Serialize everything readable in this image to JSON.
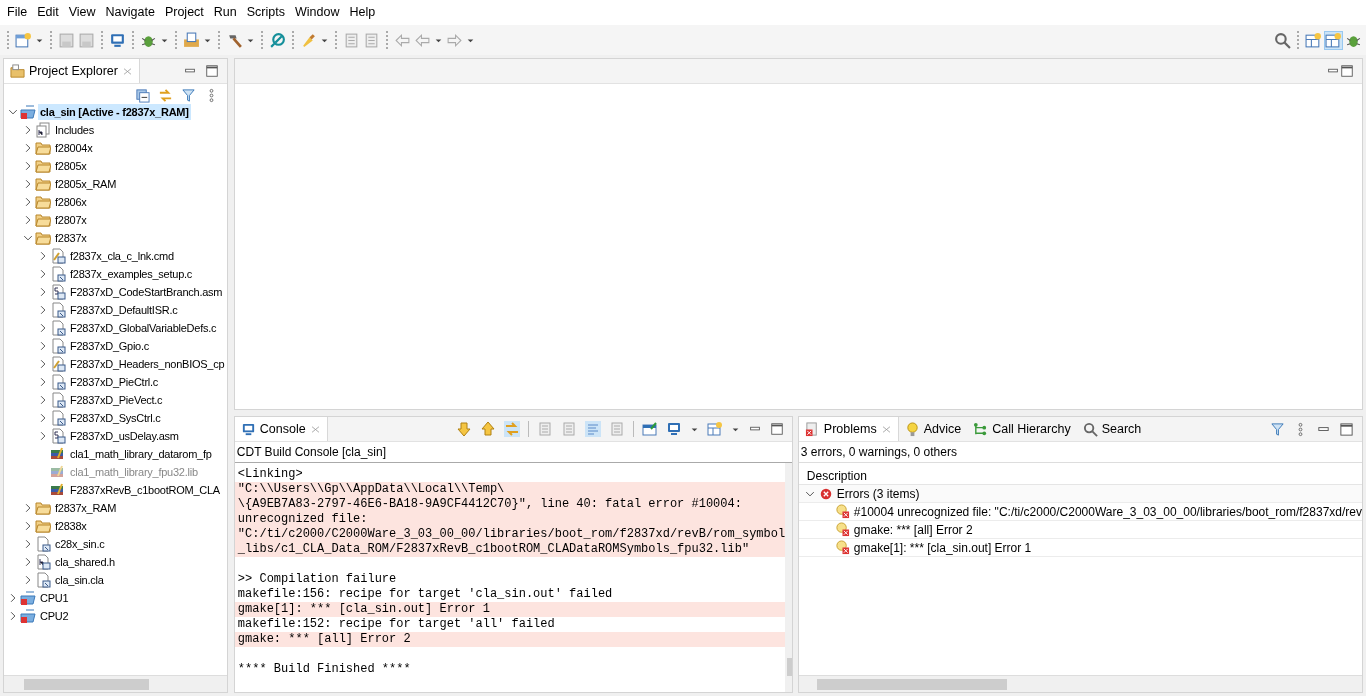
{
  "menu": [
    "File",
    "Edit",
    "View",
    "Navigate",
    "Project",
    "Run",
    "Scripts",
    "Window",
    "Help"
  ],
  "explorer": {
    "title": "Project Explorer",
    "tree": [
      {
        "label": "cla_sin  [Active - f2837x_RAM]",
        "kind": "project",
        "expanded": true,
        "selected": true,
        "children": [
          {
            "label": "Includes",
            "kind": "includes",
            "expanded": false,
            "selected": false
          },
          {
            "label": "f28004x",
            "kind": "folder",
            "expanded": false,
            "selected": false
          },
          {
            "label": "f2805x",
            "kind": "folder",
            "expanded": false,
            "selected": false
          },
          {
            "label": "f2805x_RAM",
            "kind": "folder",
            "expanded": false,
            "selected": false
          },
          {
            "label": "f2806x",
            "kind": "folder",
            "expanded": false,
            "selected": false
          },
          {
            "label": "f2807x",
            "kind": "folder",
            "expanded": false,
            "selected": false
          },
          {
            "label": "f2837x",
            "kind": "folder",
            "expanded": true,
            "selected": false,
            "children": [
              {
                "label": "f2837x_cla_c_lnk.cmd",
                "kind": "cmd",
                "expanded": false,
                "selected": false,
                "greyed": false
              },
              {
                "label": "f2837x_examples_setup.c",
                "kind": "file",
                "expanded": false,
                "selected": false,
                "greyed": false
              },
              {
                "label": "F2837xD_CodeStartBranch.asm",
                "kind": "asm",
                "expanded": false,
                "selected": false,
                "greyed": false
              },
              {
                "label": "F2837xD_DefaultISR.c",
                "kind": "file",
                "expanded": false,
                "selected": false,
                "greyed": false
              },
              {
                "label": "F2837xD_GlobalVariableDefs.c",
                "kind": "file",
                "expanded": false,
                "selected": false,
                "greyed": false
              },
              {
                "label": "F2837xD_Gpio.c",
                "kind": "file",
                "expanded": false,
                "selected": false,
                "greyed": false
              },
              {
                "label": "F2837xD_Headers_nonBIOS_cp",
                "kind": "cmd",
                "expanded": false,
                "selected": false,
                "greyed": false
              },
              {
                "label": "F2837xD_PieCtrl.c",
                "kind": "file",
                "expanded": false,
                "selected": false,
                "greyed": false
              },
              {
                "label": "F2837xD_PieVect.c",
                "kind": "file",
                "expanded": false,
                "selected": false,
                "greyed": false
              },
              {
                "label": "F2837xD_SysCtrl.c",
                "kind": "file",
                "expanded": false,
                "selected": false,
                "greyed": false
              },
              {
                "label": "F2837xD_usDelay.asm",
                "kind": "asm",
                "expanded": false,
                "selected": false,
                "greyed": false
              },
              {
                "label": "cla1_math_library_datarom_fp",
                "kind": "lib",
                "selected": false,
                "greyed": false
              },
              {
                "label": "cla1_math_library_fpu32.lib",
                "kind": "lib",
                "selected": false,
                "greyed": true
              },
              {
                "label": "F2837xRevB_c1bootROM_CLA",
                "kind": "lib",
                "selected": false,
                "greyed": false
              }
            ]
          },
          {
            "label": "f2837x_RAM",
            "kind": "folder",
            "expanded": false,
            "selected": false
          },
          {
            "label": "f2838x",
            "kind": "folder",
            "expanded": false,
            "selected": false
          },
          {
            "label": "c28x_sin.c",
            "kind": "file",
            "expanded": false,
            "selected": false
          },
          {
            "label": "cla_shared.h",
            "kind": "header",
            "expanded": false,
            "selected": false
          },
          {
            "label": "cla_sin.cla",
            "kind": "file",
            "expanded": false,
            "selected": false
          }
        ]
      },
      {
        "label": "CPU1",
        "kind": "project",
        "expanded": false,
        "selected": false
      },
      {
        "label": "CPU2",
        "kind": "project",
        "expanded": false,
        "selected": false
      }
    ]
  },
  "console": {
    "tab": "Console",
    "subtitle": "CDT Build Console [cla_sin]",
    "blocks": [
      {
        "lines": [
          {
            "text": "<Linking>",
            "error": false
          },
          {
            "text": "\"C:\\\\Users\\\\Gp\\\\AppData\\\\Local\\\\Temp\\",
            "error": true
          },
          {
            "text": "\\{A9EB7A83-2797-46E6-BA18-9A9CF4412C70}\", line 40: fatal error #10004:",
            "error": true
          },
          {
            "text": "unrecognized file:",
            "error": true
          },
          {
            "text": "\"C:/ti/c2000/C2000Ware_3_03_00_00/libraries/boot_rom/f2837xd/revB/rom_symbol",
            "error": true
          },
          {
            "text": "_libs/c1_CLA_Data_ROM/F2837xRevB_c1bootROM_CLADataROMSymbols_fpu32.lib\"",
            "error": true
          }
        ]
      },
      {
        "lines": [
          {
            "text": ">> Compilation failure",
            "error": false
          },
          {
            "text": "makefile:156: recipe for target 'cla_sin.out' failed",
            "error": false
          },
          {
            "text": "gmake[1]: *** [cla_sin.out] Error 1",
            "error": true
          },
          {
            "text": "makefile:152: recipe for target 'all' failed",
            "error": false
          },
          {
            "text": "gmake: *** [all] Error 2",
            "error": true
          }
        ]
      },
      {
        "lines": [
          {
            "text": "**** Build Finished ****",
            "error": false
          }
        ]
      }
    ]
  },
  "problems": {
    "tabs": [
      {
        "label": "Problems",
        "kind": "problems",
        "selected": true
      },
      {
        "label": "Advice",
        "kind": "advice",
        "selected": false
      },
      {
        "label": "Call Hierarchy",
        "kind": "hierarchy",
        "selected": false
      },
      {
        "label": "Search",
        "kind": "search",
        "selected": false
      }
    ],
    "summary": "3 errors, 0 warnings, 0 others",
    "column": "Description",
    "group": {
      "label": "Errors (3 items)",
      "expanded": true,
      "items": [
        "#10004 unrecognized file:  \"C:/ti/c2000/C2000Ware_3_03_00_00/libraries/boot_rom/f2837xd/rev",
        "gmake: *** [all] Error 2",
        "gmake[1]: *** [cla_sin.out] Error 1"
      ]
    }
  }
}
